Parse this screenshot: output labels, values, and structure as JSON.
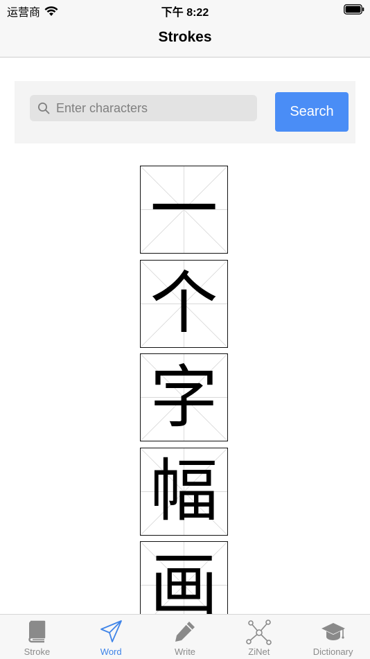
{
  "status_bar": {
    "carrier": "运营商",
    "time": "下午 8:22"
  },
  "nav": {
    "title": "Strokes"
  },
  "search": {
    "placeholder": "Enter characters",
    "value": "",
    "button_label": "Search"
  },
  "characters": [
    "一",
    "个",
    "字",
    "幅",
    "画"
  ],
  "tabs": [
    {
      "label": "Stroke",
      "icon": "book-icon",
      "active": false
    },
    {
      "label": "Word",
      "icon": "paper-plane-icon",
      "active": true
    },
    {
      "label": "Write",
      "icon": "pencil-icon",
      "active": false
    },
    {
      "label": "ZiNet",
      "icon": "network-icon",
      "active": false
    },
    {
      "label": "Dictionary",
      "icon": "graduation-cap-icon",
      "active": false
    }
  ],
  "colors": {
    "accent": "#4a8df6",
    "tab_active": "#3f84e8",
    "tab_inactive": "#8a8a8a"
  }
}
